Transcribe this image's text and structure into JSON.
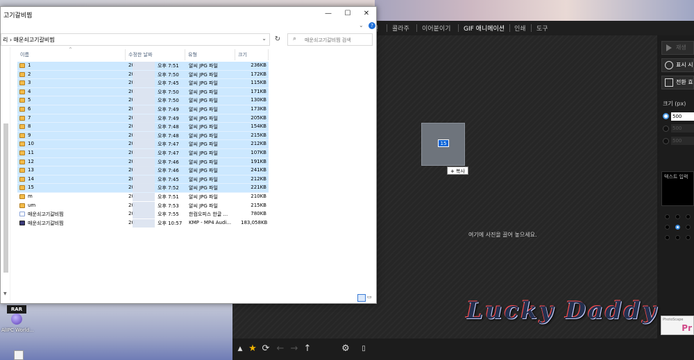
{
  "desktop": {
    "icon_rar_label": "RAR",
    "icon_label": "AlIPC World..."
  },
  "explorer": {
    "title": "고기갈비찜",
    "address_prefix": "리",
    "address_path": "매운쇠고기갈비찜",
    "search_placeholder": "매운쇠고기갈비찜 검색",
    "columns": [
      "이름",
      "수정한 날짜",
      "유형",
      "크기"
    ],
    "files": [
      {
        "name": "1",
        "date": "20",
        "time": "오후 7:51",
        "type": "알씨 JPG 파일",
        "size": "236KB",
        "icon": "image",
        "selected": true
      },
      {
        "name": "2",
        "date": "20",
        "time": "오후 7:50",
        "type": "알씨 JPG 파일",
        "size": "172KB",
        "icon": "image",
        "selected": true
      },
      {
        "name": "3",
        "date": "20",
        "time": "오후 7:45",
        "type": "알씨 JPG 파일",
        "size": "115KB",
        "icon": "image",
        "selected": true
      },
      {
        "name": "4",
        "date": "20",
        "time": "오후 7:50",
        "type": "알씨 JPG 파일",
        "size": "171KB",
        "icon": "image",
        "selected": true
      },
      {
        "name": "5",
        "date": "20",
        "time": "오후 7:50",
        "type": "알씨 JPG 파일",
        "size": "130KB",
        "icon": "image",
        "selected": true
      },
      {
        "name": "6",
        "date": "20",
        "time": "오후 7:49",
        "type": "알씨 JPG 파일",
        "size": "173KB",
        "icon": "image",
        "selected": true
      },
      {
        "name": "7",
        "date": "20",
        "time": "오후 7:49",
        "type": "알씨 JPG 파일",
        "size": "205KB",
        "icon": "image",
        "selected": true
      },
      {
        "name": "8",
        "date": "20",
        "time": "오후 7:48",
        "type": "알씨 JPG 파일",
        "size": "154KB",
        "icon": "image",
        "selected": true
      },
      {
        "name": "9",
        "date": "20",
        "time": "오후 7:48",
        "type": "알씨 JPG 파일",
        "size": "215KB",
        "icon": "image",
        "selected": true
      },
      {
        "name": "10",
        "date": "20",
        "time": "오후 7:47",
        "type": "알씨 JPG 파일",
        "size": "212KB",
        "icon": "image",
        "selected": true
      },
      {
        "name": "11",
        "date": "20",
        "time": "오후 7:47",
        "type": "알씨 JPG 파일",
        "size": "107KB",
        "icon": "image",
        "selected": true
      },
      {
        "name": "12",
        "date": "20",
        "time": "오후 7:46",
        "type": "알씨 JPG 파일",
        "size": "191KB",
        "icon": "image",
        "selected": true
      },
      {
        "name": "13",
        "date": "20",
        "time": "오후 7:46",
        "type": "알씨 JPG 파일",
        "size": "241KB",
        "icon": "image",
        "selected": true
      },
      {
        "name": "14",
        "date": "20",
        "time": "오후 7:45",
        "type": "알씨 JPG 파일",
        "size": "212KB",
        "icon": "image",
        "selected": true
      },
      {
        "name": "15",
        "date": "20",
        "time": "오후 7:52",
        "type": "알씨 JPG 파일",
        "size": "221KB",
        "icon": "image",
        "selected": true
      },
      {
        "name": "m",
        "date": "20",
        "time": "오후 7:51",
        "type": "알씨 JPG 파일",
        "size": "210KB",
        "icon": "image",
        "selected": false
      },
      {
        "name": "um",
        "date": "20",
        "time": "오후 7:53",
        "type": "알씨 JPG 파일",
        "size": "215KB",
        "icon": "image",
        "selected": false
      },
      {
        "name": "매운쇠고기갈비찜",
        "date": "20",
        "time": "오후 7:55",
        "type": "한컴오피스 한글 ...",
        "size": "780KB",
        "icon": "hwp",
        "selected": false
      },
      {
        "name": "매운쇠고기갈비찜",
        "date": "20",
        "time": "오후 10:57",
        "type": "KMP - MP4 Audi...",
        "size": "183,058KB",
        "icon": "mp4",
        "selected": false
      }
    ]
  },
  "app": {
    "menu": [
      "진",
      "콜라주",
      "이어붙이기",
      "GIF 애니메이션",
      "인쇄",
      "도구"
    ],
    "active_menu_index": 3,
    "canvas_hint": "여기에 사진을 끌어 놓으세요.",
    "drag_badge": "15",
    "copy_tooltip": "복사",
    "copy_plus": "+",
    "sidebar": {
      "play_label": "재생",
      "display_label": "표시 시",
      "transition_label": "전환 효",
      "size_label": "크기 (px)",
      "size_value": "500",
      "size_dim_1": "500",
      "size_dim_2": "500",
      "text_input_label": "텍스트 입력"
    },
    "watermark": "Lucky Daddy",
    "logo_small": "PhotoScape",
    "logo_big": "Pr"
  }
}
